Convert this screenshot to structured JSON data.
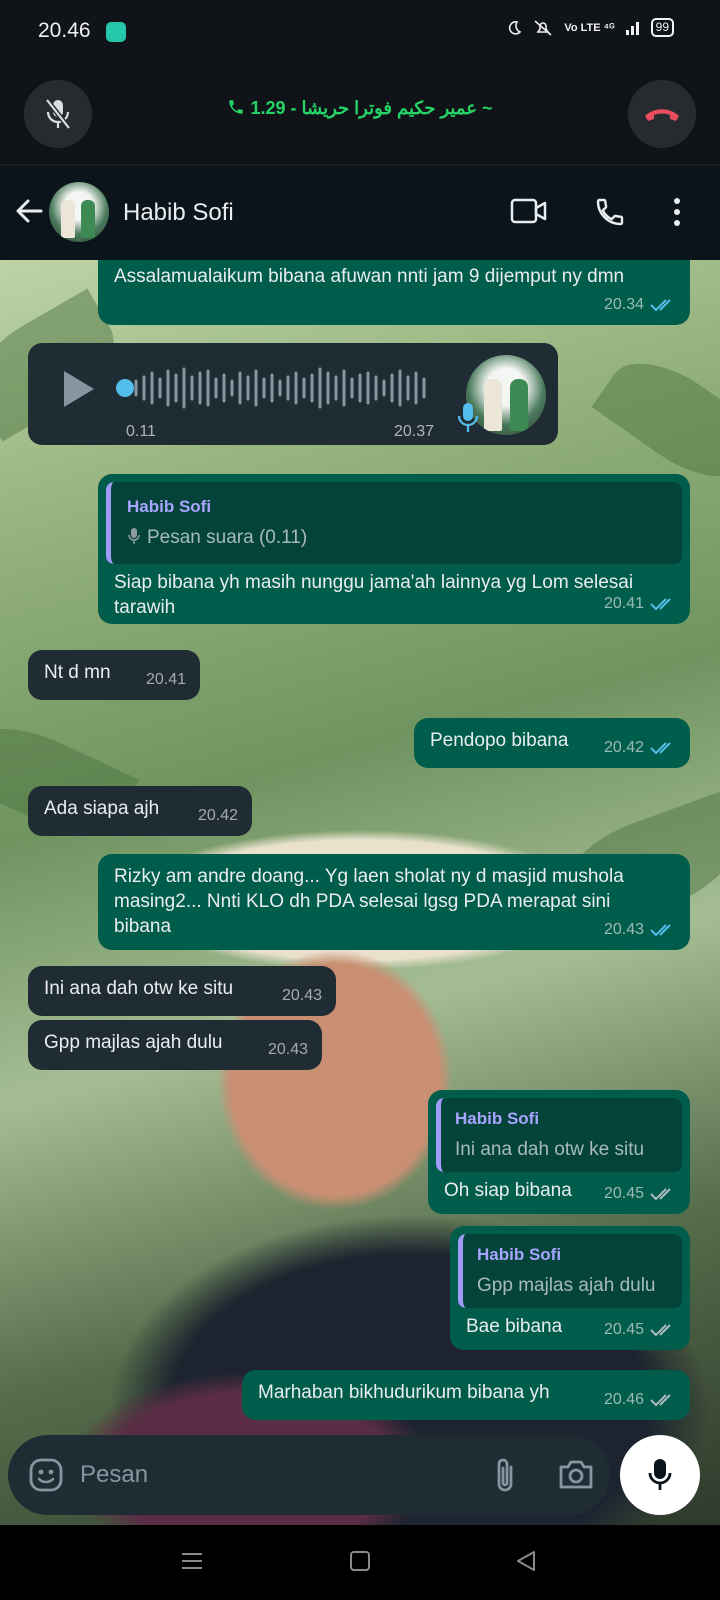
{
  "status_bar": {
    "time": "20.46",
    "network": "Vo LTE  ⁴ᴳ",
    "battery": "99"
  },
  "call_bar": {
    "caller": "عمير حكيم فوترا حريشا",
    "duration": "1.29",
    "display": "عمير حكيم فوترا حريشا - 1.29 ~",
    "accent": "#25d366",
    "end_color": "#ea4d5d"
  },
  "header": {
    "contact_name": "Habib Sofi"
  },
  "messages": [
    {
      "type": "out",
      "text": "Assalamualaikum bibana afuwan nnti jam 9 dijemput ny dmn",
      "time": "20.34",
      "status": "read"
    },
    {
      "type": "voice_in",
      "duration": "0.11",
      "time": "20.37"
    },
    {
      "type": "out",
      "quote_name": "Habib Sofi",
      "quote_text": "Pesan suara (0.11)",
      "text": "Siap bibana yh masih nunggu jama'ah lainnya yg Lom selesai tarawih",
      "time": "20.41",
      "status": "read"
    },
    {
      "type": "in",
      "text": "Nt d mn",
      "time": "20.41"
    },
    {
      "type": "out",
      "text": "Pendopo bibana",
      "time": "20.42",
      "status": "read"
    },
    {
      "type": "in",
      "text": "Ada siapa ajh",
      "time": "20.42"
    },
    {
      "type": "out",
      "text": "Rizky am andre doang... Yg laen sholat ny d masjid mushola masing2... Nnti KLO dh PDA selesai lgsg PDA merapat sini bibana",
      "time": "20.43",
      "status": "read"
    },
    {
      "type": "in",
      "text": "Ini ana dah otw ke situ",
      "time": "20.43"
    },
    {
      "type": "in",
      "text": "Gpp majlas ajah dulu",
      "time": "20.43"
    },
    {
      "type": "out",
      "quote_name": "Habib Sofi",
      "quote_text": "Ini ana dah otw ke situ",
      "text": "Oh siap bibana",
      "time": "20.45",
      "status": "delivered"
    },
    {
      "type": "out",
      "quote_name": "Habib Sofi",
      "quote_text": "Gpp majlas ajah dulu",
      "text": "Bae bibana",
      "time": "20.45",
      "status": "delivered"
    },
    {
      "type": "out",
      "text": "Marhaban bikhudurikum bibana yh",
      "time": "20.46",
      "status": "delivered"
    }
  ],
  "colors": {
    "read_tick": "#53bdeb",
    "delivered_tick": "#aebac1",
    "outgoing_bubble": "#005c4b",
    "incoming_bubble": "#202c33"
  },
  "composer": {
    "placeholder": "Pesan",
    "value": ""
  },
  "icons": [
    "mic-off-icon",
    "call-end-icon",
    "phone-icon",
    "back-arrow-icon",
    "video-call-icon",
    "voice-call-icon",
    "more-vert-icon",
    "play-icon",
    "mic-icon",
    "emoji-icon",
    "attach-icon",
    "camera-icon"
  ]
}
